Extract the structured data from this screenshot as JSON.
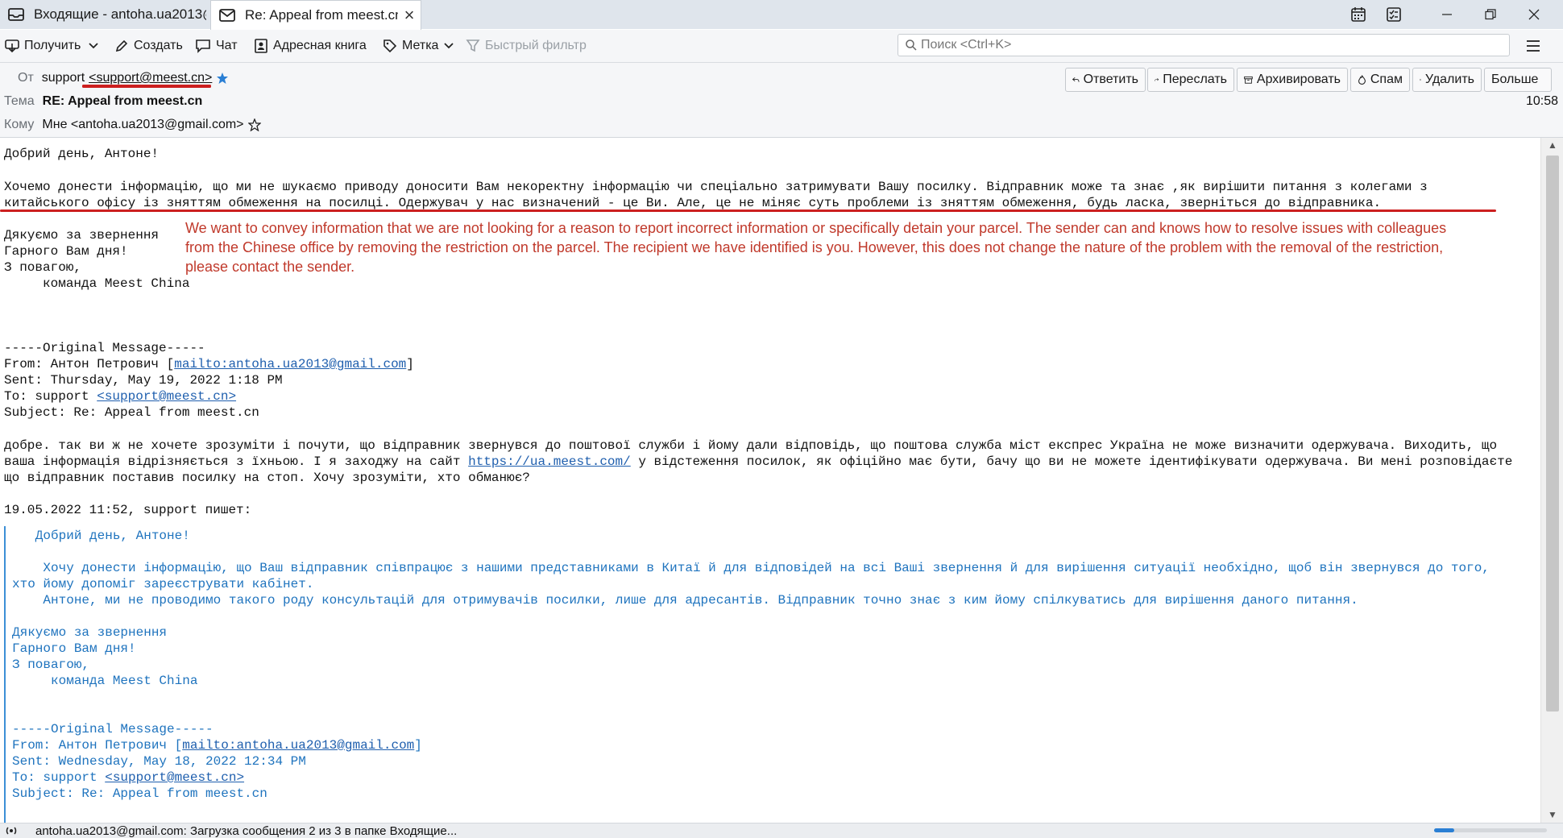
{
  "tabs": [
    {
      "title": "Входящие - antoha.ua2013@gma"
    },
    {
      "title": "Re: Appeal from meest.cn - ",
      "close": "×"
    }
  ],
  "toolbar": {
    "get": "Получить",
    "compose": "Создать",
    "chat": "Чат",
    "addressbook": "Адресная книга",
    "tag": "Метка",
    "quickfilter": "Быстрый фильтр",
    "search_placeholder": "Поиск <Ctrl+K>"
  },
  "header": {
    "from_label": "От",
    "from_name": "support",
    "from_email": "<support@meest.cn>",
    "subject_label": "Тема",
    "subject": "RE: Appeal from meest.cn",
    "to_label": "Кому",
    "to_value": "Мне <antoha.ua2013@gmail.com>",
    "time": "10:58",
    "buttons": {
      "reply": "Ответить",
      "forward": "Переслать",
      "archive": "Архивировать",
      "spam": "Спам",
      "delete": "Удалить",
      "more": "Больше"
    }
  },
  "body": {
    "greeting": "Добрий день, Антоне!",
    "para1_line1": "Хочемо донести інформацію, що ми не шукаємо приводу доносити Вам некоректну інформацію чи спеціально затримувати Вашу посилку. Відправник може та знає ,як вирішити питання з колегами з",
    "para1_line2": "китайського офісу із зняттям обмеження на посилці. Одержувач у нас визначений - це Ви. Але, це не міняє суть проблеми із зняттям обмеження, будь ласка, зверніться до відправника.",
    "thanks": "Дякуємо за звернення",
    "goodday": "Гарного Вам дня!",
    "regards": "З повагою,",
    "team": "     команда Meest China",
    "translation": "We want to convey information that we are not looking for a reason to report incorrect information or specifically detain your parcel. The sender can and knows how to resolve issues with colleagues from the Chinese office by removing the restriction on the parcel. The recipient we have identified is you. However, this does not change the nature of the problem with the removal of the restriction, please contact the sender.",
    "orig_header": "-----Original Message-----",
    "orig_from_prefix": "From: Антон Петрович [",
    "orig_from_link": "mailto:antoha.ua2013@gmail.com",
    "orig_from_suffix": "]",
    "orig_sent": "Sent: Thursday, May 19, 2022 1:18 PM",
    "orig_to_prefix": "To: support ",
    "orig_to_link": "<support@meest.cn>",
    "orig_subject": "Subject: Re: Appeal from meest.cn",
    "reply_line1": "добре. так ви ж не хочете зрозуміти і почути, що відправник звернувся до поштової служби і йому дали відповідь, що поштова служба міст експрес Україна не може визначити одержувача. Виходить, що",
    "reply_line2_prefix": "ваша інформація відрізняється з їхньою. І я заходжу на сайт ",
    "reply_link": "https://ua.meest.com/",
    "reply_line2_suffix": " у відстеження посилок, як офіційно має бути, бачу що ви не можете ідентифікувати одержувача. Ви мені розповідаєте",
    "reply_line3": "що відправник поставив посилку на стоп. Хочу зрозуміти, хто обманює?",
    "quote_intro": "19.05.2022 11:52, support пишет:",
    "q_greeting": "   Добрий день, Антоне!",
    "q_line1": "    Хочу донести інформацію, що Ваш відправник співпрацює з нашими представниками в Китаї й для відповідей на всі Ваші звернення й для вирішення ситуації необхідно, щоб він звернувся до того,",
    "q_line2": "хто йому допоміг зареєструвати кабінет.",
    "q_line3": "    Антоне, ми не проводимо такого роду консультацій для отримувачів посилки, лише для адресантів. Відправник точно знає з ким йому спілкуватись для вирішення даного питання.",
    "q_thanks": "Дякуємо за звернення",
    "q_goodday": "Гарного Вам дня!",
    "q_regards": "З повагою,",
    "q_team": "     команда Meest China",
    "q_orig_header": "-----Original Message-----",
    "q_from_prefix": "From: Антон Петрович [",
    "q_from_link": "mailto:antoha.ua2013@gmail.com",
    "q_from_suffix": "]",
    "q_sent": "Sent: Wednesday, May 18, 2022 12:34 PM",
    "q_to_prefix": "To: support ",
    "q_to_link": "<support@meest.cn>",
    "q_subject": "Subject: Re: Appeal from meest.cn"
  },
  "status": {
    "text": "antoha.ua2013@gmail.com: Загрузка сообщения 2 из 3 в папке Входящие...",
    "progress": 0.18
  },
  "colors": {
    "annotation_red": "#cc1f1f",
    "quote_blue": "#1e73be",
    "link_blue": "#1f5fae"
  }
}
